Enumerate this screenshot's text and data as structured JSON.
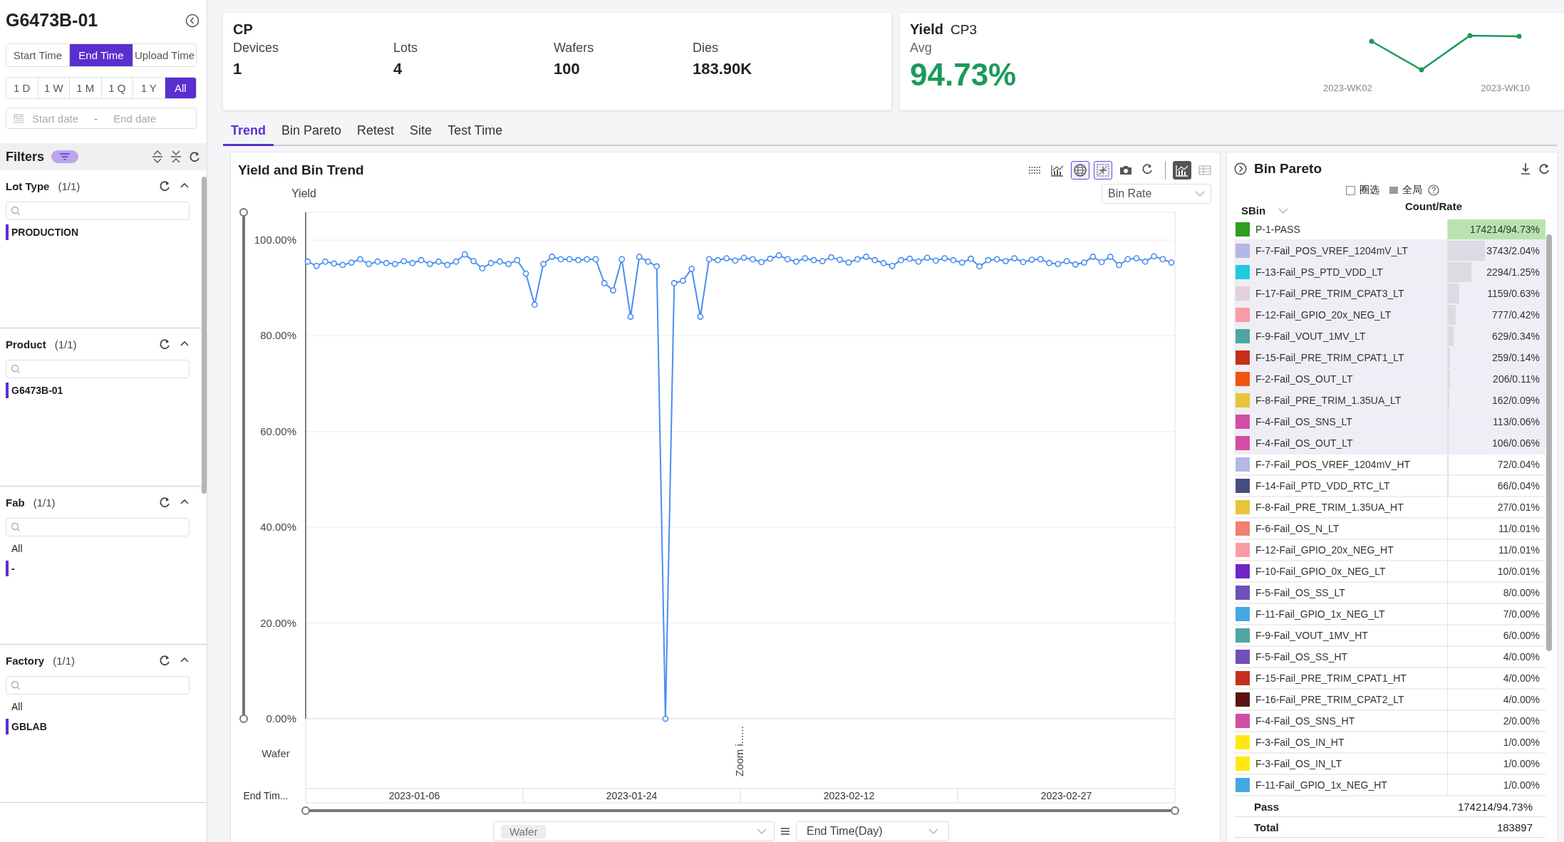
{
  "sidebar": {
    "title": "G6473B-01",
    "time_modes": [
      {
        "label": "Start Time",
        "selected": false
      },
      {
        "label": "End Time",
        "selected": true
      },
      {
        "label": "Upload Time",
        "selected": false
      }
    ],
    "ranges": [
      {
        "label": "1 D",
        "selected": false
      },
      {
        "label": "1 W",
        "selected": false
      },
      {
        "label": "1 M",
        "selected": false
      },
      {
        "label": "1 Q",
        "selected": false
      },
      {
        "label": "1 Y",
        "selected": false
      },
      {
        "label": "All",
        "selected": true
      }
    ],
    "date_range": {
      "start_placeholder": "Start date",
      "separator": "-",
      "end_placeholder": "End date"
    },
    "filters_label": "Filters",
    "filter_groups": [
      {
        "name": "Lot Type",
        "count": "(1/1)",
        "items": [
          {
            "label": "PRODUCTION",
            "selected": true
          }
        ]
      },
      {
        "name": "Product",
        "count": "(1/1)",
        "items": [
          {
            "label": "G6473B-01",
            "selected": true
          }
        ]
      },
      {
        "name": "Fab",
        "count": "(1/1)",
        "items": [
          {
            "label": "All",
            "selected": false
          },
          {
            "label": "-",
            "selected": true
          }
        ]
      },
      {
        "name": "Factory",
        "count": "(1/1)",
        "items": [
          {
            "label": "All",
            "selected": false
          },
          {
            "label": "GBLAB",
            "selected": true
          }
        ]
      }
    ]
  },
  "summary": {
    "title": "CP",
    "stats": [
      {
        "label": "Devices",
        "value": "1"
      },
      {
        "label": "Lots",
        "value": "4"
      },
      {
        "label": "Wafers",
        "value": "100"
      },
      {
        "label": "Dies",
        "value": "183.90K"
      }
    ]
  },
  "yield_card": {
    "title": "Yield",
    "stage": "CP3",
    "label": "Avg",
    "value": "94.73%",
    "axis_labels": [
      "2023-WK02",
      "2023-WK10"
    ]
  },
  "tabs": [
    {
      "label": "Trend",
      "selected": true
    },
    {
      "label": "Bin Pareto",
      "selected": false
    },
    {
      "label": "Retest",
      "selected": false
    },
    {
      "label": "Site",
      "selected": false
    },
    {
      "label": "Test Time",
      "selected": false
    }
  ],
  "trend": {
    "title": "Yield and Bin Trend",
    "toolbar": [
      {
        "kind": "dotted-lines",
        "on": false
      },
      {
        "kind": "bar-line",
        "on": false
      },
      {
        "kind": "globe",
        "on": true
      },
      {
        "kind": "crosshair",
        "on": true
      },
      {
        "kind": "camera",
        "on": false
      },
      {
        "kind": "refresh",
        "on": false
      },
      {
        "kind": "chart-view",
        "on": true
      },
      {
        "kind": "table-view",
        "on": false
      }
    ],
    "metric_select": "Bin Rate",
    "chart_data": {
      "type": "line",
      "ylabel": "Yield",
      "grid": true,
      "ylim": [
        0,
        100
      ],
      "yticks": [
        {
          "value": 0,
          "label": "0.00%"
        },
        {
          "value": 20,
          "label": "20.00%"
        },
        {
          "value": 40,
          "label": "40.00%"
        },
        {
          "value": 60,
          "label": "60.00%"
        },
        {
          "value": 80,
          "label": "80.00%"
        },
        {
          "value": 100,
          "label": "100.00%"
        }
      ],
      "series": [
        {
          "color": "#4a8ef0",
          "marker": "circle",
          "values": [
            95.5,
            94.6,
            95.5,
            95.1,
            94.8,
            95.3,
            96,
            95,
            95.5,
            95.2,
            95,
            95.6,
            95.2,
            95.8,
            95,
            95.5,
            94.8,
            95.5,
            97,
            95.6,
            94.1,
            95.2,
            95.5,
            95,
            95.8,
            93,
            86.5,
            95,
            96.5,
            96,
            96,
            95.8,
            96,
            96,
            91,
            89.5,
            96,
            84,
            96.5,
            95.5,
            94.5,
            0,
            91,
            91.5,
            94,
            84,
            96,
            95.8,
            96.2,
            95.7,
            96.3,
            96,
            95.4,
            96.1,
            96.8,
            96,
            95.5,
            96.2,
            95.8,
            95.6,
            96.4,
            95.9,
            95.3,
            96,
            96.5,
            95.8,
            95.2,
            94.6,
            95.8,
            96.1,
            95.5,
            96.3,
            95.7,
            96.2,
            95.8,
            95.3,
            96.1,
            94.5,
            95.8,
            96,
            95.6,
            96.2,
            95.4,
            95.9,
            96,
            95.2,
            95,
            95.6,
            94.9,
            95.3,
            96.5,
            95.4,
            96.5,
            94.8,
            96,
            96.2,
            95.5,
            96.6,
            96,
            95.3
          ]
        }
      ]
    },
    "x_axis_label": "Wafer",
    "date_axis_label": "End Tim...",
    "dates": [
      "2023-01-06",
      "2023-01-24",
      "2023-02-12",
      "2023-02-27"
    ],
    "zoom_hint": "Zoom i......",
    "group_by": "Wafer",
    "time_group": "End Time(Day)"
  },
  "bin_pareto": {
    "title": "Bin Pareto",
    "legend": [
      {
        "kind": "checkbox",
        "label": "圈选",
        "checked": false
      },
      {
        "kind": "swatch",
        "label": "全局"
      }
    ],
    "columns": [
      "SBin",
      "Count/Rate"
    ],
    "rows": [
      {
        "name": "P-1-PASS",
        "color": "#2e9e1e",
        "count_rate": "174214/94.73%",
        "level": 1,
        "highlighted": false
      },
      {
        "name": "F-7-Fail_POS_VREF_1204mV_LT",
        "color": "#b3b8e6",
        "count_rate": "3743/2.04%",
        "level": 0.38,
        "highlighted": true
      },
      {
        "name": "F-13-Fail_PS_PTD_VDD_LT",
        "color": "#22c9dd",
        "count_rate": "2294/1.25%",
        "level": 0.24,
        "highlighted": true
      },
      {
        "name": "F-17-Fail_PRE_TRIM_CPAT3_LT",
        "color": "#e6d0dc",
        "count_rate": "1159/0.63%",
        "level": 0.12,
        "highlighted": true
      },
      {
        "name": "F-12-Fail_GPIO_20x_NEG_LT",
        "color": "#f79ca4",
        "count_rate": "777/0.42%",
        "level": 0.08,
        "highlighted": true
      },
      {
        "name": "F-9-Fail_VOUT_1MV_LT",
        "color": "#4ea6a0",
        "count_rate": "629/0.34%",
        "level": 0.06,
        "highlighted": true
      },
      {
        "name": "F-15-Fail_PRE_TRIM_CPAT1_LT",
        "color": "#c4301a",
        "count_rate": "259/0.14%",
        "level": 0.025,
        "highlighted": true
      },
      {
        "name": "F-2-Fail_OS_OUT_LT",
        "color": "#f0560f",
        "count_rate": "206/0.11%",
        "level": 0.02,
        "highlighted": true
      },
      {
        "name": "F-8-Fail_PRE_TRIM_1.35UA_LT",
        "color": "#e8c43a",
        "count_rate": "162/0.09%",
        "level": 0.015,
        "highlighted": true
      },
      {
        "name": "F-4-Fail_OS_SNS_LT",
        "color": "#d14ea4",
        "count_rate": "113/0.06%",
        "level": 0.01,
        "highlighted": true
      },
      {
        "name": "F-4-Fail_OS_OUT_LT",
        "color": "#d14ea4",
        "count_rate": "106/0.06%",
        "level": 0.01,
        "highlighted": true
      },
      {
        "name": "F-7-Fail_POS_VREF_1204mV_HT",
        "color": "#b3b8e6",
        "count_rate": "72/0.04%",
        "level": 0.005,
        "highlighted": false
      },
      {
        "name": "F-14-Fail_PTD_VDD_RTC_LT",
        "color": "#454e80",
        "count_rate": "66/0.04%",
        "level": 0.005,
        "highlighted": false
      },
      {
        "name": "F-8-Fail_PRE_TRIM_1.35UA_HT",
        "color": "#e8c43a",
        "count_rate": "27/0.01%",
        "highlighted": false
      },
      {
        "name": "F-6-Fail_OS_N_LT",
        "color": "#f08070",
        "count_rate": "11/0.01%",
        "highlighted": false
      },
      {
        "name": "F-12-Fail_GPIO_20x_NEG_HT",
        "color": "#f79ca4",
        "count_rate": "11/0.01%",
        "highlighted": false
      },
      {
        "name": "F-10-Fail_GPIO_0x_NEG_LT",
        "color": "#7124c8",
        "count_rate": "10/0.01%",
        "highlighted": false
      },
      {
        "name": "F-5-Fail_OS_SS_LT",
        "color": "#6f4fb8",
        "count_rate": "8/0.00%",
        "highlighted": false
      },
      {
        "name": "F-11-Fail_GPIO_1x_NEG_LT",
        "color": "#46a8e2",
        "count_rate": "7/0.00%",
        "highlighted": false
      },
      {
        "name": "F-9-Fail_VOUT_1MV_HT",
        "color": "#4ea6a0",
        "count_rate": "6/0.00%",
        "highlighted": false
      },
      {
        "name": "F-5-Fail_OS_SS_HT",
        "color": "#6f4fb8",
        "count_rate": "4/0.00%",
        "highlighted": false
      },
      {
        "name": "F-15-Fail_PRE_TRIM_CPAT1_HT",
        "color": "#c4301a",
        "count_rate": "4/0.00%",
        "highlighted": false
      },
      {
        "name": "F-16-Fail_PRE_TRIM_CPAT2_LT",
        "color": "#5a1510",
        "count_rate": "4/0.00%",
        "highlighted": false
      },
      {
        "name": "F-4-Fail_OS_SNS_HT",
        "color": "#d14ea4",
        "count_rate": "2/0.00%",
        "highlighted": false
      },
      {
        "name": "F-3-Fail_OS_IN_HT",
        "color": "#ffe812",
        "count_rate": "1/0.00%",
        "highlighted": false
      },
      {
        "name": "F-3-Fail_OS_IN_LT",
        "color": "#ffe812",
        "count_rate": "1/0.00%",
        "highlighted": false
      },
      {
        "name": "F-11-Fail_GPIO_1x_NEG_HT",
        "color": "#46a8e2",
        "count_rate": "1/0.00%",
        "highlighted": false
      }
    ],
    "pass_label": "Pass",
    "pass_value": "174214/94.73%",
    "total_label": "Total",
    "total_value": "183897"
  }
}
